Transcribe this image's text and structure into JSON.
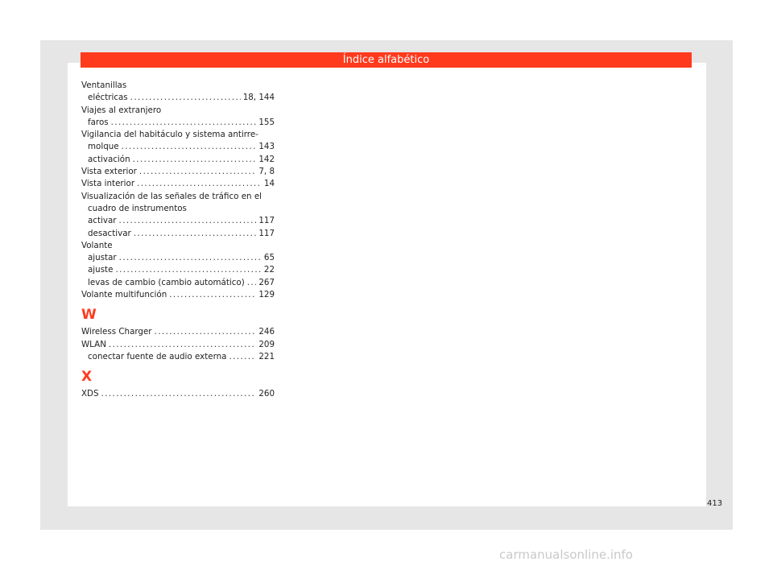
{
  "header": {
    "title": "Índice alfabético"
  },
  "index": [
    {
      "type": "heading",
      "label": "Ventanillas"
    },
    {
      "type": "entry",
      "sub": true,
      "label": "eléctricas",
      "page": "18, 144"
    },
    {
      "type": "heading",
      "label": "Viajes al extranjero"
    },
    {
      "type": "entry",
      "sub": true,
      "label": "faros",
      "page": "155"
    },
    {
      "type": "heading",
      "label": "Vigilancia del habitáculo y sistema antirre-"
    },
    {
      "type": "entry",
      "sub": true,
      "label": "molque",
      "page": "143"
    },
    {
      "type": "entry",
      "sub": true,
      "label": "activación",
      "page": "142"
    },
    {
      "type": "entry",
      "sub": false,
      "label": "Vista exterior",
      "page": "7, 8"
    },
    {
      "type": "entry",
      "sub": false,
      "label": "Vista interior",
      "page": "14"
    },
    {
      "type": "heading",
      "label": "Visualización de las señales de tráfico en el"
    },
    {
      "type": "heading",
      "sub": true,
      "label": "cuadro de instrumentos"
    },
    {
      "type": "entry",
      "sub": true,
      "label": "activar",
      "page": "117"
    },
    {
      "type": "entry",
      "sub": true,
      "label": "desactivar",
      "page": "117"
    },
    {
      "type": "heading",
      "label": "Volante"
    },
    {
      "type": "entry",
      "sub": true,
      "label": "ajustar",
      "page": "65"
    },
    {
      "type": "entry",
      "sub": true,
      "label": "ajuste",
      "page": "22"
    },
    {
      "type": "entry",
      "sub": true,
      "label": "levas de cambio (cambio automático)",
      "page": "267"
    },
    {
      "type": "entry",
      "sub": false,
      "label": "Volante multifunción",
      "page": "129"
    },
    {
      "type": "letter",
      "label": "W"
    },
    {
      "type": "entry",
      "sub": false,
      "label": "Wireless Charger",
      "page": "246"
    },
    {
      "type": "entry",
      "sub": false,
      "label": "WLAN",
      "page": "209"
    },
    {
      "type": "entry",
      "sub": true,
      "label": "conectar fuente de audio externa",
      "page": "221"
    },
    {
      "type": "letter",
      "label": "X"
    },
    {
      "type": "entry",
      "sub": false,
      "label": "XDS",
      "page": "260"
    }
  ],
  "footer": {
    "page_number": "413"
  },
  "watermark": "carmanualsonline.info",
  "colors": {
    "accent": "#ff3a1d",
    "frame": "#e6e6e6"
  }
}
